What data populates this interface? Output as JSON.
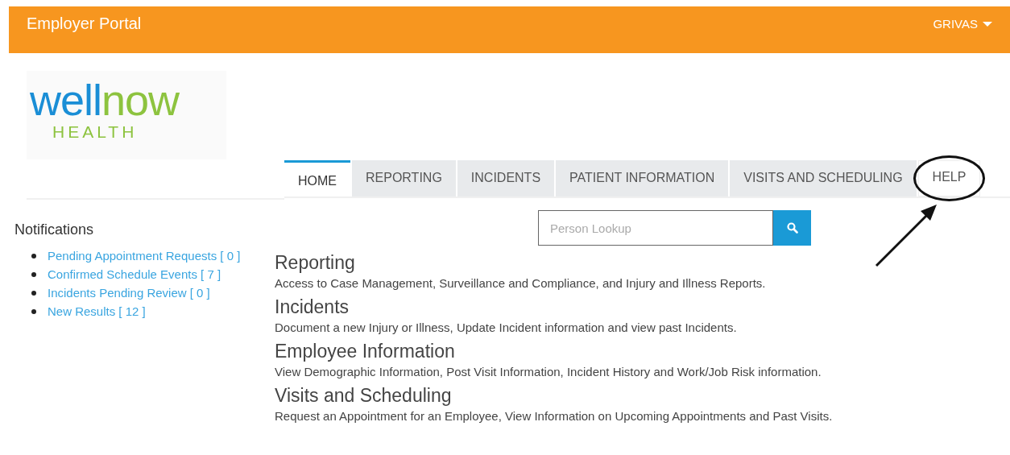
{
  "header": {
    "title": "Employer Portal",
    "user": "GRIVAS"
  },
  "logo": {
    "word_1": "well",
    "word_2": "now",
    "tagline": "HEALTH"
  },
  "tabs": [
    {
      "label": "HOME",
      "selected": true
    },
    {
      "label": "REPORTING",
      "selected": false
    },
    {
      "label": "INCIDENTS",
      "selected": false
    },
    {
      "label": "PATIENT INFORMATION",
      "selected": false
    },
    {
      "label": "VISITS AND SCHEDULING",
      "selected": false
    },
    {
      "label": "HELP",
      "selected": false,
      "circled": true
    }
  ],
  "search": {
    "placeholder": "Person Lookup"
  },
  "notifications": {
    "title": "Notifications",
    "items": [
      "Pending Appointment Requests [ 0 ]",
      "Confirmed Schedule Events [ 7 ]",
      "Incidents Pending Review [ 0 ]",
      "New Results [ 12 ]"
    ]
  },
  "sections": [
    {
      "title": "Reporting",
      "text": "Access to Case Management, Surveillance and Compliance, and Injury and Illness Reports."
    },
    {
      "title": "Incidents",
      "text": "Document a new Injury or Illness, Update Incident information and view past Incidents."
    },
    {
      "title": "Employee Information",
      "text": "View Demographic Information, Post Visit Information, Incident History and Work/Job Risk information."
    },
    {
      "title": "Visits and Scheduling",
      "text": "Request an Appointment for an Employee, View Information on Upcoming Appointments and Past Visits."
    }
  ],
  "annotations": [
    {
      "kind": "arrow"
    }
  ]
}
